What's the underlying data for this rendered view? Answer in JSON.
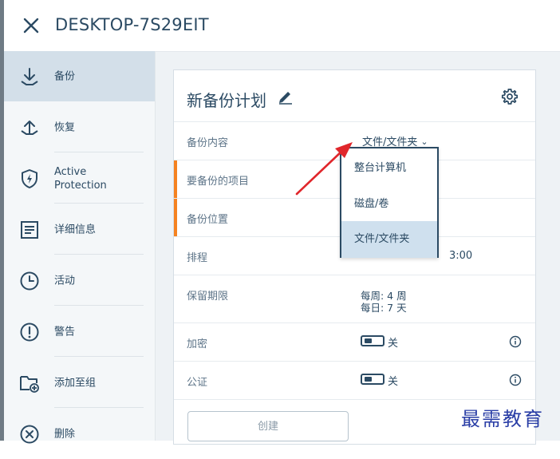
{
  "window": {
    "title": "DESKTOP-7S29EIT"
  },
  "sidebar": {
    "items": [
      {
        "label": "备份",
        "icon": "download-arrow-icon",
        "active": true
      },
      {
        "label": "恢复",
        "icon": "upload-arrow-icon",
        "active": false
      },
      {
        "label": "Active Protection",
        "icon": "shield-bolt-icon",
        "active": false
      },
      {
        "label": "详细信息",
        "icon": "details-list-icon",
        "active": false
      },
      {
        "label": "活动",
        "icon": "clock-icon",
        "active": false
      },
      {
        "label": "警告",
        "icon": "exclamation-circle-icon",
        "active": false
      },
      {
        "label": "添加至组",
        "icon": "folder-plus-icon",
        "active": false
      },
      {
        "label": "删除",
        "icon": "close-circle-icon",
        "active": false
      }
    ]
  },
  "plan": {
    "title": "新备份计划",
    "rows": {
      "content": {
        "label": "备份内容",
        "value": "文件/文件夹"
      },
      "items": {
        "label": "要备份的项目"
      },
      "location": {
        "label": "备份位置"
      },
      "schedule": {
        "label": "排程",
        "value_partial": "3:00"
      },
      "retention": {
        "label": "保留期限",
        "weekly": "每周: 4 周",
        "daily": "每日: 7 天"
      },
      "encryption": {
        "label": "加密",
        "toggle_label": "关"
      },
      "notary": {
        "label": "公证",
        "toggle_label": "关"
      }
    },
    "create_button": "创建"
  },
  "dropdown": {
    "options": [
      {
        "label": "整台计算机",
        "selected": false
      },
      {
        "label": "磁盘/卷",
        "selected": false
      },
      {
        "label": "文件/文件夹",
        "selected": true
      }
    ]
  },
  "watermark": "最需教育",
  "colors": {
    "accent_orange": "#f58220",
    "text_navy": "#2b4a63",
    "selected_blue": "#cfe0ee",
    "arrow_red": "#e0262b"
  }
}
